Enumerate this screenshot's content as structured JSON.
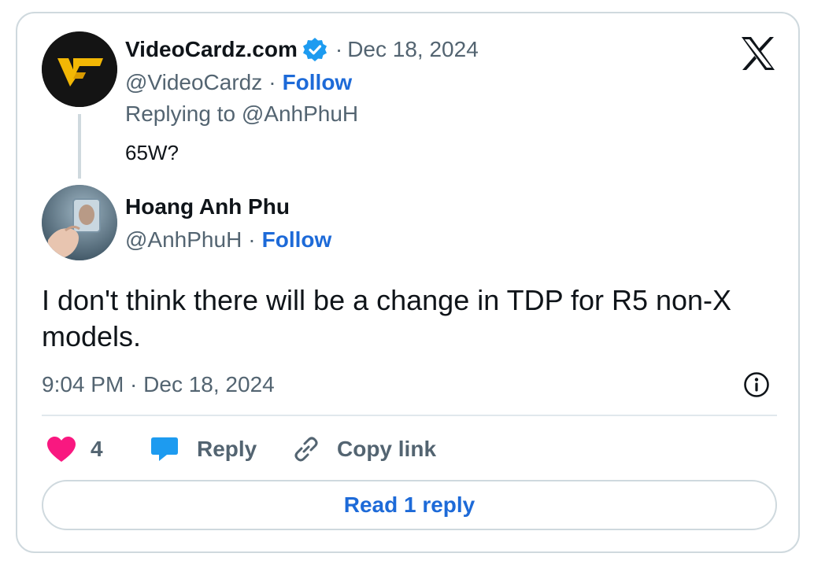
{
  "reply_tweet": {
    "author_name": "VideoCardz.com",
    "verified": true,
    "date": "Dec 18, 2024",
    "handle": "@VideoCardz",
    "follow_label": "Follow",
    "replying_to": "Replying to @AnhPhuH",
    "text": "65W?"
  },
  "main_tweet": {
    "author_name": "Hoang Anh Phu",
    "handle": "@AnhPhuH",
    "follow_label": "Follow",
    "text": "I don't think there will be a change in TDP for R5 non-X models.",
    "timestamp": "9:04 PM · Dec 18, 2024"
  },
  "actions": {
    "like_count": "4",
    "reply_label": "Reply",
    "copy_link_label": "Copy link"
  },
  "read_replies_label": "Read 1 reply",
  "colors": {
    "follow_blue": "#1d6ad8",
    "verified_blue": "#1d9bf0",
    "like_pink": "#f91880",
    "reply_blue": "#1d9bf0",
    "border": "#cfd9de",
    "muted_text": "#536471"
  }
}
